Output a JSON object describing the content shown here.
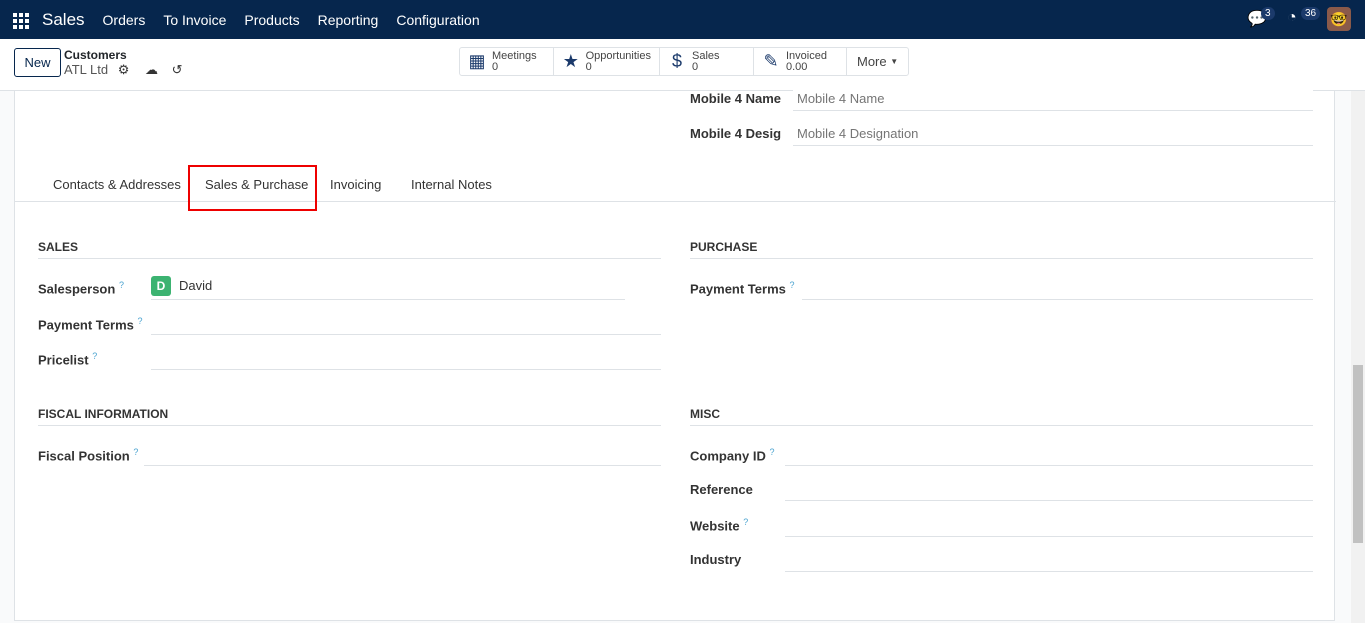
{
  "nav": {
    "brand": "Sales",
    "menu": [
      "Orders",
      "To Invoice",
      "Products",
      "Reporting",
      "Configuration"
    ],
    "messages_count": "3",
    "activities_count": "36"
  },
  "control": {
    "new_label": "New",
    "breadcrumb": "Customers",
    "record": "ATL Ltd"
  },
  "smart_buttons": [
    {
      "icon": "calendar-icon",
      "label": "Meetings",
      "value": "0"
    },
    {
      "icon": "star-icon",
      "label": "Opportunities",
      "value": "0"
    },
    {
      "icon": "dollar-icon",
      "label": "Sales",
      "value": "0"
    },
    {
      "icon": "edit-icon",
      "label": "Invoiced",
      "value": "0.00"
    }
  ],
  "more_label": "More",
  "top_fields": [
    {
      "label": "Mobile 4 Name",
      "placeholder": "Mobile 4 Name"
    },
    {
      "label": "Mobile 4 Desig",
      "placeholder": "Mobile 4 Designation"
    }
  ],
  "tabs": [
    "Contacts & Addresses",
    "Sales & Purchase",
    "Invoicing",
    "Internal Notes"
  ],
  "active_tab": "Sales & Purchase",
  "sales": {
    "title": "SALES",
    "salesperson_label": "Salesperson",
    "salesperson_initial": "D",
    "salesperson": "David",
    "payment_terms_label": "Payment Terms",
    "pricelist_label": "Pricelist"
  },
  "purchase": {
    "title": "PURCHASE",
    "payment_terms_label": "Payment Terms"
  },
  "fiscal": {
    "title": "FISCAL INFORMATION",
    "fiscal_position_label": "Fiscal Position"
  },
  "misc": {
    "title": "MISC",
    "company_id_label": "Company ID",
    "reference_label": "Reference",
    "website_label": "Website",
    "industry_label": "Industry"
  },
  "help_mark": "?"
}
